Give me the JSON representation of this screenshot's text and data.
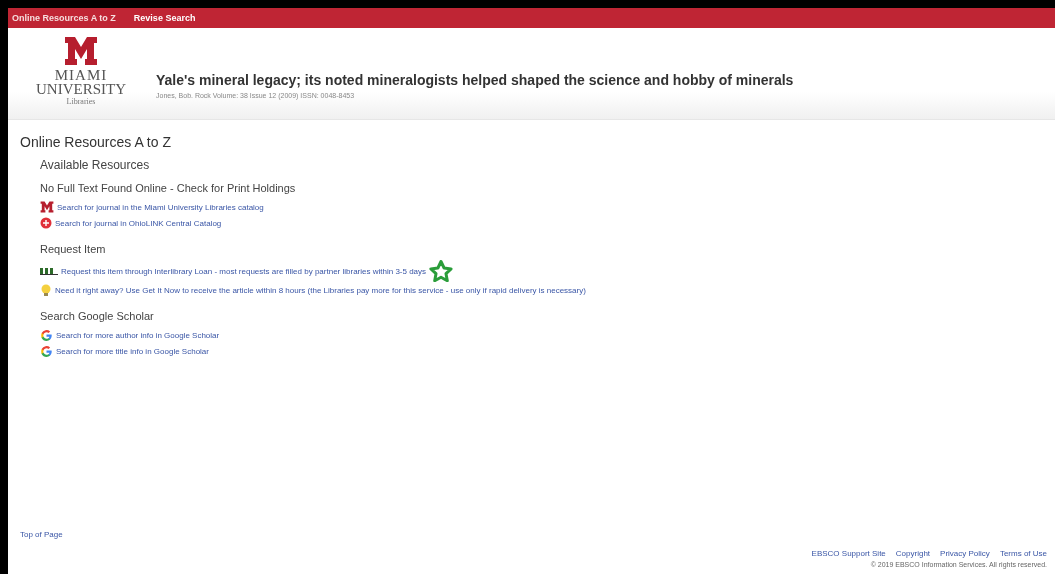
{
  "top_nav": [
    {
      "label": "Online Resources A to Z",
      "selected": true
    },
    {
      "label": "Revise Search",
      "selected": false
    }
  ],
  "logo": {
    "line_1": "MIAMI",
    "line_2": "UNIVERSITY",
    "line_3": "Libraries"
  },
  "article": {
    "title": "Yale's mineral legacy; its noted mineralogists helped shaped the science and hobby of minerals",
    "citation": "Jones, Bob. Rock Volume: 38 Issue 12 (2009) ISSN: 0048-8453"
  },
  "page_title": "Online Resources A to Z",
  "subtitle": "Available Resources",
  "sections": [
    {
      "heading": "No Full Text Found Online - Check for Print Holdings",
      "links": [
        {
          "kind": "miami",
          "text": "Search for journal in the Miami University Libraries catalog"
        },
        {
          "kind": "ohiolink",
          "text": "Search for journal in OhioLINK Central Catalog"
        }
      ]
    },
    {
      "heading": "Request Item",
      "links": [
        {
          "kind": "ill",
          "text": "Request this item through Interlibrary Loan - most requests are filled by partner libraries within 3-5 days",
          "star": true
        },
        {
          "kind": "bulb",
          "text": "Need it right away? Use Get It Now to receive the article within 8 hours (the Libraries pay more for this service - use only if rapid delivery is necessary)"
        }
      ]
    },
    {
      "heading": "Search Google Scholar",
      "links": [
        {
          "kind": "google",
          "text": "Search for more author info in Google Scholar"
        },
        {
          "kind": "google",
          "text": "Search for more title info in Google Scholar"
        }
      ]
    }
  ],
  "top_link": "Top of Page",
  "footer_links": [
    "EBSCO Support Site",
    "Copyright",
    "Privacy Policy",
    "Terms of Use"
  ],
  "copyright": "© 2019 EBSCO Information Services. All rights reserved."
}
